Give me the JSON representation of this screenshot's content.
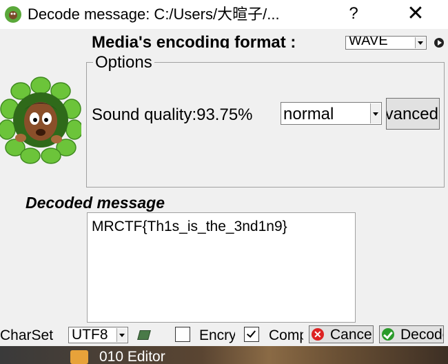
{
  "window": {
    "title": "Decode message: C:/Users/大暄子/...",
    "help_label": "?",
    "close_label": "✕"
  },
  "header": {
    "encoding_label": "Media's encoding format :",
    "encoding_value": "WAVE"
  },
  "options": {
    "legend": "Options",
    "quality_label": "Sound quality:93.75%",
    "quality_value": "normal",
    "advanced_label": "Advanced"
  },
  "decoded": {
    "label": "Decoded message",
    "message": "MRCTF{Th1s_is_the_3nd1n9}"
  },
  "footer": {
    "charset_label": "CharSet",
    "charset_value": "UTF8",
    "encrypt_label": "Encrypt",
    "encrypt_checked": false,
    "compress_label": "Compress",
    "compress_checked": true,
    "cancel_label": "Cancel",
    "decode_label": "Decode"
  },
  "taskbar": {
    "app_label": "010 Editor"
  }
}
